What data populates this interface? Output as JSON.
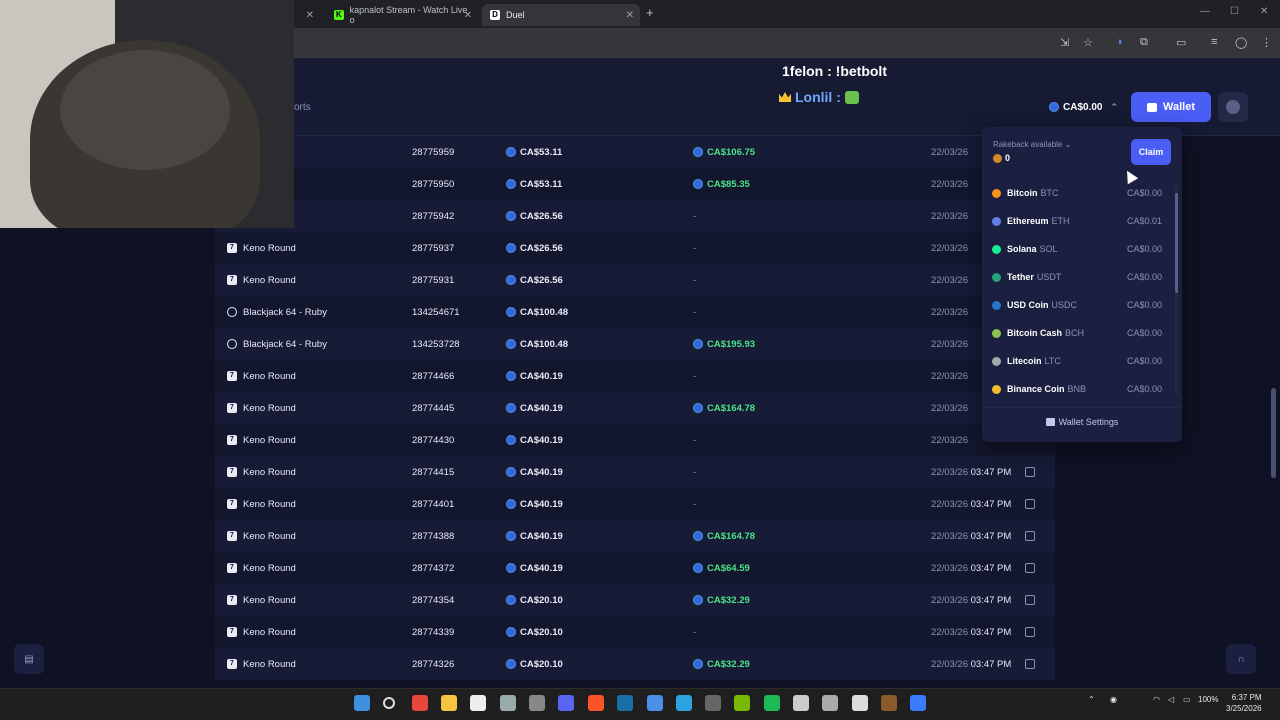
{
  "browser": {
    "tabs": [
      {
        "label": "kapnalot Stream - Watch Live o",
        "favicon": "K"
      },
      {
        "label": "Duel",
        "favicon": "D"
      }
    ]
  },
  "stream": {
    "title_line1": "1felon : !betbolt",
    "title_line2": "Lonlil :"
  },
  "nav": {
    "sports_label": "orts"
  },
  "header": {
    "balance": "CA$0.00",
    "wallet_label": "Wallet"
  },
  "bets": [
    {
      "game": "",
      "id": "28775959",
      "bet": "CA$53.11",
      "payout": "CA$106.75",
      "date": "22/03/26",
      "time": ""
    },
    {
      "game": "",
      "id": "28775950",
      "bet": "CA$53.11",
      "payout": "CA$85.35",
      "date": "22/03/26",
      "time": ""
    },
    {
      "game": "",
      "id": "28775942",
      "bet": "CA$26.56",
      "payout": "-",
      "date": "22/03/26",
      "time": ""
    },
    {
      "game": "Keno Round",
      "id": "28775937",
      "bet": "CA$26.56",
      "payout": "-",
      "date": "22/03/26",
      "time": ""
    },
    {
      "game": "Keno Round",
      "id": "28775931",
      "bet": "CA$26.56",
      "payout": "-",
      "date": "22/03/26",
      "time": ""
    },
    {
      "game": "Blackjack 64 - Ruby",
      "id": "134254671",
      "bet": "CA$100.48",
      "payout": "-",
      "date": "22/03/26",
      "time": ""
    },
    {
      "game": "Blackjack 64 - Ruby",
      "id": "134253728",
      "bet": "CA$100.48",
      "payout": "CA$195.93",
      "date": "22/03/26",
      "time": ""
    },
    {
      "game": "Keno Round",
      "id": "28774466",
      "bet": "CA$40.19",
      "payout": "-",
      "date": "22/03/26",
      "time": ""
    },
    {
      "game": "Keno Round",
      "id": "28774445",
      "bet": "CA$40.19",
      "payout": "CA$164.78",
      "date": "22/03/26",
      "time": ""
    },
    {
      "game": "Keno Round",
      "id": "28774430",
      "bet": "CA$40.19",
      "payout": "-",
      "date": "22/03/26",
      "time": ""
    },
    {
      "game": "Keno Round",
      "id": "28774415",
      "bet": "CA$40.19",
      "payout": "-",
      "date": "22/03/26",
      "time": "03:47 PM"
    },
    {
      "game": "Keno Round",
      "id": "28774401",
      "bet": "CA$40.19",
      "payout": "-",
      "date": "22/03/26",
      "time": "03:47 PM"
    },
    {
      "game": "Keno Round",
      "id": "28774388",
      "bet": "CA$40.19",
      "payout": "CA$164.78",
      "date": "22/03/26",
      "time": "03:47 PM"
    },
    {
      "game": "Keno Round",
      "id": "28774372",
      "bet": "CA$40.19",
      "payout": "CA$64.59",
      "date": "22/03/26",
      "time": "03:47 PM"
    },
    {
      "game": "Keno Round",
      "id": "28774354",
      "bet": "CA$20.10",
      "payout": "CA$32.29",
      "date": "22/03/26",
      "time": "03:47 PM"
    },
    {
      "game": "Keno Round",
      "id": "28774339",
      "bet": "CA$20.10",
      "payout": "-",
      "date": "22/03/26",
      "time": "03:47 PM"
    },
    {
      "game": "Keno Round",
      "id": "28774326",
      "bet": "CA$20.10",
      "payout": "CA$32.29",
      "date": "22/03/26",
      "time": "03:47 PM"
    }
  ],
  "wallet_dropdown": {
    "rakeback_label": "Rakeback available",
    "rakeback_value": "0",
    "claim_label": "Claim",
    "currencies": [
      {
        "name": "Bitcoin",
        "symbol": "BTC",
        "amount": "CA$0.00",
        "color": "#f7931a"
      },
      {
        "name": "Ethereum",
        "symbol": "ETH",
        "amount": "CA$0.01",
        "color": "#627eea"
      },
      {
        "name": "Solana",
        "symbol": "SOL",
        "amount": "CA$0.00",
        "color": "#14f195"
      },
      {
        "name": "Tether",
        "symbol": "USDT",
        "amount": "CA$0.00",
        "color": "#26a17b"
      },
      {
        "name": "USD Coin",
        "symbol": "USDC",
        "amount": "CA$0.00",
        "color": "#2775ca"
      },
      {
        "name": "Bitcoin Cash",
        "symbol": "BCH",
        "amount": "CA$0.00",
        "color": "#8dc351"
      },
      {
        "name": "Litecoin",
        "symbol": "LTC",
        "amount": "CA$0.00",
        "color": "#a6a9aa"
      },
      {
        "name": "Binance Coin",
        "symbol": "BNB",
        "amount": "CA$0.00",
        "color": "#f3ba2f"
      }
    ],
    "settings_label": "Wallet Settings"
  },
  "system": {
    "battery": "100%",
    "time": "6:37 PM",
    "date": "3/25/2026"
  }
}
